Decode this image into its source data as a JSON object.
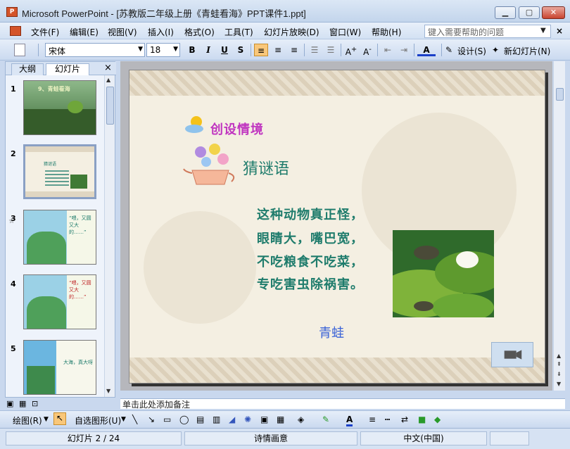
{
  "window": {
    "title": "Microsoft PowerPoint - [苏教版二年级上册《青蛙看海》PPT课件1.ppt]",
    "controls": [
      "minimize",
      "maximize",
      "close"
    ]
  },
  "menu": {
    "items": [
      "文件(F)",
      "编辑(E)",
      "视图(V)",
      "插入(I)",
      "格式(O)",
      "工具(T)",
      "幻灯片放映(D)",
      "窗口(W)",
      "帮助(H)"
    ],
    "help_placeholder": "键入需要帮助的问题",
    "close_glyph": "×"
  },
  "toolbar": {
    "font": "宋体",
    "size": "18",
    "bold": "B",
    "italic": "I",
    "underline": "U",
    "shadow": "S",
    "design_label": "设计(S)",
    "new_slide_label": "新幻灯片(N)"
  },
  "left_pane": {
    "tabs": [
      "大纲",
      "幻灯片"
    ],
    "active_tab": "幻灯片",
    "close_glyph": "×",
    "thumbnails": [
      {
        "num": "1",
        "text": "9、青蛙看海"
      },
      {
        "num": "2",
        "text": "猜谜语",
        "selected": true
      },
      {
        "num": "3",
        "text": "“喂，又圆又大的……”"
      },
      {
        "num": "4",
        "text": "“喂，又圆又大的……”"
      },
      {
        "num": "5",
        "text": "大海，真大呀"
      }
    ]
  },
  "slide": {
    "section_title": "创设情境",
    "riddle_title": "猜谜语",
    "riddle_lines": [
      "这种动物真正怪，",
      "眼睛大，嘴巴宽，",
      "不吃粮食不吃菜，",
      "专吃害虫除祸害。"
    ],
    "answer": "青蛙"
  },
  "notes": {
    "placeholder": "单击此处添加备注"
  },
  "drawbar": {
    "draw_label": "绘图(R)",
    "autoshapes_label": "自选图形(U)"
  },
  "status": {
    "slide_position": "幻灯片 2 / 24",
    "design_name": "诗情画意",
    "language": "中文(中国)"
  },
  "colors": {
    "riddle_text": "#1f7c6c",
    "section_title": "#c035c0",
    "answer": "#3b63d7"
  }
}
